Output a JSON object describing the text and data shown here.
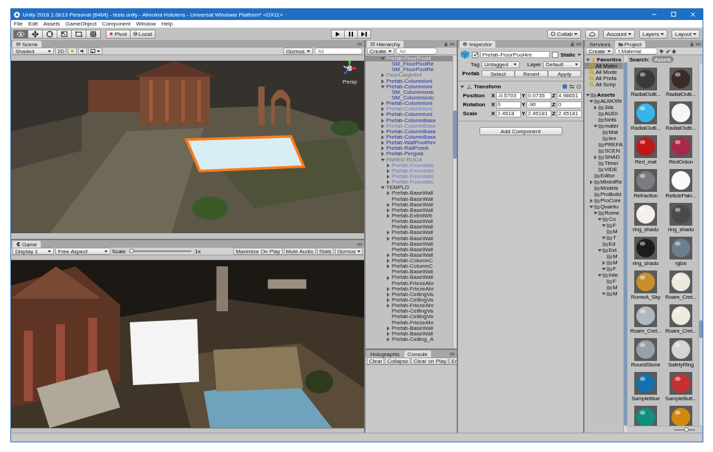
{
  "window": {
    "title": "Unity 2018.1.0b13 Personal (64bit) - tesis.unity - Almoina Hololens - Universal Windows Platform* <DX11>"
  },
  "menu": [
    "File",
    "Edit",
    "Assets",
    "GameObject",
    "Component",
    "Window",
    "Help"
  ],
  "toolbar": {
    "tools": [
      {
        "kind": "view",
        "selected": true
      },
      {
        "kind": "move",
        "selected": false
      },
      {
        "kind": "rotate",
        "selected": false
      },
      {
        "kind": "scale",
        "selected": false
      },
      {
        "kind": "rect",
        "selected": false
      },
      {
        "kind": "transform",
        "selected": false
      }
    ],
    "pivot": "Pivot",
    "space": "Local",
    "playback": [
      {
        "kind": "play"
      },
      {
        "kind": "pause"
      },
      {
        "kind": "step"
      }
    ],
    "collab": "Collab",
    "account": "Account",
    "layers": "Layers",
    "layout": "Layout"
  },
  "scene": {
    "tab": "Scene",
    "shading": "Shaded",
    "mode_2d": "2D",
    "gizmos": "Gizmos",
    "search_placeholder": "All",
    "camera_label": "Persp"
  },
  "game": {
    "tab": "Game",
    "display": "Display 1",
    "aspect": "Free Aspect",
    "scale_label": "Scale",
    "scale": {
      "level": 0
    },
    "scale_value": "1x",
    "buttons": [
      "Maximize On Play",
      "Mute Audio",
      "Stats",
      "Gizmos"
    ]
  },
  "hierarchy": {
    "tab": "Hierarchy",
    "create": "Create",
    "search_placeholder": "All",
    "items": [
      {
        "label": "Prefab-FloorPool4",
        "kind": "prefab",
        "selected": true,
        "expanded": true,
        "children": [
          {
            "label": "SM_FloorPoolRe",
            "kind": "prefab",
            "selected": false
          },
          {
            "label": "SM_FloorPoolRe",
            "kind": "prefab",
            "selected": false
          }
        ]
      },
      {
        "label": "FloorLarge4x4",
        "kind": "inactive",
        "selected": false,
        "expanded": false
      },
      {
        "label": "Prefab-ColumnIoni",
        "kind": "prefab",
        "selected": false,
        "expanded": false
      },
      {
        "label": "Prefab-ColumnIoni",
        "kind": "prefab",
        "selected": false,
        "expanded": true,
        "children": [
          {
            "label": "SM_ColumnIonic",
            "kind": "prefab",
            "selected": false
          },
          {
            "label": "SM_ColumnIonic",
            "kind": "prefab",
            "selected": false
          }
        ]
      },
      {
        "label": "Prefab-ColumnIoni",
        "kind": "prefab",
        "selected": false,
        "expanded": false
      },
      {
        "label": "Prefab-ColumnIoni",
        "kind": "prefab-inactive",
        "selected": false,
        "expanded": false
      },
      {
        "label": "Prefab-ColumnIoni",
        "kind": "prefab",
        "selected": false,
        "expanded": false
      },
      {
        "label": "Prefab-ColumnBase",
        "kind": "prefab",
        "selected": false,
        "expanded": false
      },
      {
        "label": "Prefab-ColumnBase",
        "kind": "prefab-inactive",
        "selected": false,
        "expanded": false
      },
      {
        "label": "Prefab-ColumnBase",
        "kind": "prefab",
        "selected": false,
        "expanded": false
      },
      {
        "label": "Prefab-ColumnBase",
        "kind": "prefab",
        "selected": false,
        "expanded": false
      },
      {
        "label": "Prefab-WallPoolRev",
        "kind": "prefab",
        "selected": false,
        "expanded": false
      },
      {
        "label": "Prefab-RailPostA",
        "kind": "prefab",
        "selected": false,
        "expanded": false
      },
      {
        "label": "Prefab-Pergola",
        "kind": "prefab",
        "selected": false,
        "expanded": false
      },
      {
        "label": "PARED ROCA",
        "kind": "inactive",
        "selected": false,
        "expanded": true,
        "children": [
          {
            "label": "Prefab-Foundatic",
            "kind": "prefab-inactive",
            "selected": false,
            "expanded": false
          },
          {
            "label": "Prefab-Foundatic",
            "kind": "prefab-inactive",
            "selected": false,
            "expanded": false
          },
          {
            "label": "Prefab-Foundatic",
            "kind": "prefab-inactive",
            "selected": false,
            "expanded": false
          },
          {
            "label": "Prefab-Foundatic",
            "kind": "prefab-inactive",
            "selected": false,
            "expanded": false
          }
        ]
      },
      {
        "label": "TEMPLO",
        "kind": "plain",
        "selected": false,
        "expanded": true,
        "children": [
          {
            "label": "Prefab-BaseWall",
            "kind": "plain",
            "selected": false,
            "expanded": false
          },
          {
            "label": "Prefab-BaseWall",
            "kind": "plain",
            "selected": false
          },
          {
            "label": "Prefab-BaseWall",
            "kind": "plain",
            "selected": false,
            "expanded": false
          },
          {
            "label": "Prefab-BaseWall",
            "kind": "plain",
            "selected": false,
            "expanded": false
          },
          {
            "label": "Prefab-ExtIntWb",
            "kind": "plain",
            "selected": false,
            "expanded": false
          },
          {
            "label": "Prefab-BaseWall",
            "kind": "plain",
            "selected": false
          },
          {
            "label": "Prefab-BaseWall",
            "kind": "plain",
            "selected": false
          },
          {
            "label": "Prefab-BaseWall",
            "kind": "plain",
            "selected": false,
            "expanded": false
          },
          {
            "label": "Prefab-BaseWall",
            "kind": "plain",
            "selected": false,
            "expanded": false
          },
          {
            "label": "Prefab-BaseWall",
            "kind": "plain",
            "selected": false
          },
          {
            "label": "Prefab-BaseWall",
            "kind": "plain",
            "selected": false
          },
          {
            "label": "Prefab-BaseWall",
            "kind": "plain",
            "selected": false,
            "expanded": false
          },
          {
            "label": "Prefab-ColumnC",
            "kind": "plain",
            "selected": false,
            "expanded": false
          },
          {
            "label": "Prefab-ColumnC",
            "kind": "plain",
            "selected": false,
            "expanded": false
          },
          {
            "label": "Prefab-BaseWall",
            "kind": "plain",
            "selected": false
          },
          {
            "label": "Prefab-BaseWall",
            "kind": "plain",
            "selected": false,
            "expanded": false
          },
          {
            "label": "Prefab-FriezeAbr",
            "kind": "plain",
            "selected": false
          },
          {
            "label": "Prefab-FriezeAbr",
            "kind": "plain",
            "selected": false,
            "expanded": false
          },
          {
            "label": "Prefab-CeilingVa",
            "kind": "plain",
            "selected": false,
            "expanded": false
          },
          {
            "label": "Prefab-CeilingVa",
            "kind": "plain",
            "selected": false,
            "expanded": false
          },
          {
            "label": "Prefab-FriezeAbr",
            "kind": "plain",
            "selected": false,
            "expanded": false
          },
          {
            "label": "Prefab-CeilingVa",
            "kind": "plain",
            "selected": false
          },
          {
            "label": "Prefab-CeilingVa",
            "kind": "plain",
            "selected": false
          },
          {
            "label": "Prefab-FriezeAbr",
            "kind": "plain",
            "selected": false
          },
          {
            "label": "Prefab-BaseWall",
            "kind": "plain",
            "selected": false,
            "expanded": false
          },
          {
            "label": "Prefab-BaseWall",
            "kind": "plain",
            "selected": false,
            "expanded": false
          },
          {
            "label": "Prefab-Ceiling_A",
            "kind": "plain",
            "selected": false,
            "expanded": false
          }
        ]
      }
    ]
  },
  "console": {
    "tabs": [
      {
        "label": "Holographic",
        "selected": false
      },
      {
        "label": "Console",
        "selected": true
      }
    ],
    "buttons": [
      "Clear",
      "Collapse",
      "Clear on Play",
      "Er"
    ]
  },
  "inspector": {
    "tab": "Inspector",
    "active": true,
    "name": "Prefab-FloorPool4m",
    "static": false,
    "static_label": "Static",
    "tag_label": "Tag",
    "tag": "Untagged",
    "layer_label": "Layer",
    "layer": "Default",
    "prefab_label": "Prefab",
    "prefab_buttons": [
      "Select",
      "Revert",
      "Apply"
    ],
    "transform": {
      "title": "Transform",
      "expanded": true,
      "rows": [
        {
          "label": "Position",
          "values": [
            {
              "axis": "X",
              "value": "-0.5703"
            },
            {
              "axis": "Y",
              "value": "0.0735"
            },
            {
              "axis": "Z",
              "value": "4.98651"
            }
          ]
        },
        {
          "label": "Rotation",
          "values": [
            {
              "axis": "X",
              "value": "0"
            },
            {
              "axis": "Y",
              "value": "-90"
            },
            {
              "axis": "Z",
              "value": "0"
            }
          ]
        },
        {
          "label": "Scale",
          "values": [
            {
              "axis": "X",
              "value": "2.4518"
            },
            {
              "axis": "Y",
              "value": "2.45181"
            },
            {
              "axis": "Z",
              "value": "2.45181"
            }
          ]
        }
      ]
    },
    "add_component": "Add Component"
  },
  "project": {
    "tabs": [
      {
        "label": "Services",
        "selected": false
      },
      {
        "label": "Project",
        "selected": true
      }
    ],
    "create": "Create",
    "search": "t:Material",
    "favorites": {
      "label": "Favorites",
      "expanded": true,
      "selected": false,
      "children": [
        {
          "label": "All Mater",
          "selected": true
        },
        {
          "label": "All Mode",
          "selected": false
        },
        {
          "label": "All Prefa",
          "selected": false
        },
        {
          "label": "All Scrip",
          "selected": false
        }
      ]
    },
    "assets": {
      "label": "Assets",
      "expanded": true,
      "selected": false,
      "children": [
        {
          "label": "ALMOIN",
          "expanded": true,
          "selected": false,
          "children": [
            {
              "label": "3ds",
              "expanded": false,
              "selected": false
            },
            {
              "label": "AUDI",
              "selected": false
            },
            {
              "label": "fonts",
              "selected": false
            },
            {
              "label": "mater",
              "expanded": true,
              "selected": false,
              "children": [
                {
                  "label": "Mat",
                  "selected": false
                },
                {
                  "label": "tex",
                  "selected": false
                }
              ]
            },
            {
              "label": "PREFA",
              "selected": false
            },
            {
              "label": "SCEN",
              "selected": false
            },
            {
              "label": "SHAD",
              "expanded": false,
              "selected": false
            },
            {
              "label": "Timel",
              "selected": false
            },
            {
              "label": "VIDE",
              "selected": false
            }
          ]
        },
        {
          "label": "Editor",
          "selected": false
        },
        {
          "label": "MixedRe",
          "expanded": false,
          "selected": false
        },
        {
          "label": "Models",
          "selected": false
        },
        {
          "label": "ProBuild",
          "selected": false
        },
        {
          "label": "ProCore",
          "expanded": false,
          "selected": false
        },
        {
          "label": "Quantu",
          "expanded": true,
          "selected": false,
          "children": [
            {
              "label": "Rome",
              "expanded": true,
              "selected": false,
              "children": [
                {
                  "label": "Co",
                  "expanded": true,
                  "selected": false,
                  "children": [
                    {
                      "label": "F",
                      "expanded": true,
                      "selected": false
                    },
                    {
                      "label": "M",
                      "selected": false
                    },
                    {
                      "label": "T",
                      "expanded": true,
                      "selected": false
                    }
                  ]
                },
                {
                  "label": "Ed",
                  "selected": false
                },
                {
                  "label": "Ext",
                  "expanded": true,
                  "selected": false,
                  "children": [
                    {
                      "label": "M",
                      "selected": false
                    },
                    {
                      "label": "M",
                      "expanded": false,
                      "selected": false
                    },
                    {
                      "label": "F",
                      "expanded": true,
                      "selected": false
                    }
                  ]
                },
                {
                  "label": "Inte",
                  "expanded": true,
                  "selected": false,
                  "children": [
                    {
                      "label": "F",
                      "selected": false
                    },
                    {
                      "label": "M",
                      "selected": false
                    },
                    {
                      "label": "M",
                      "expanded": true,
                      "selected": false
                    }
                  ]
                }
              ]
            }
          ]
        }
      ]
    },
    "search_label": "Search:",
    "search_scope": "Assets",
    "thumbnail_size": {
      "level": 0.55
    },
    "materials": [
      {
        "label": "RadialOutli...",
        "color": "#3a3a3a"
      },
      {
        "label": "RadialOutli...",
        "color": "#3b2a2a"
      },
      {
        "label": "RadialOutli...",
        "color": "#37b4ea"
      },
      {
        "label": "RadialOutb...",
        "color": "#f6f6f6"
      },
      {
        "label": "Red_mat",
        "color": "#c01818"
      },
      {
        "label": "RedOnion",
        "color": "#a8284a"
      },
      {
        "label": "Refraction",
        "color": "#7c7c80"
      },
      {
        "label": "ReticlePain...",
        "color": "#fafafa"
      },
      {
        "label": "ring_shado",
        "color": "#f2f0e8"
      },
      {
        "label": "ring_shado",
        "color": "#4a4a4a"
      },
      {
        "label": "ring_shado",
        "color": "#1c1c1c"
      },
      {
        "label": "rglze",
        "color": "#6a8090"
      },
      {
        "label": "RomeA_Sky",
        "color": "#c8902a"
      },
      {
        "label": "Roam_Cret...",
        "color": "#ebe8de"
      },
      {
        "label": "Roam_Cret...",
        "color": "#b0b8c0"
      },
      {
        "label": "Roam_Cret...",
        "color": "#eeeadc"
      },
      {
        "label": "RoundStone",
        "color": "#9aa0aa"
      },
      {
        "label": "SafetyRing",
        "color": "#d4d4d4"
      },
      {
        "label": "SampleBlue",
        "color": "#1670b0"
      },
      {
        "label": "SampleButt...",
        "color": "#c83030"
      },
      {
        "color": "#10907a"
      },
      {
        "color": "#d08a10"
      }
    ]
  }
}
